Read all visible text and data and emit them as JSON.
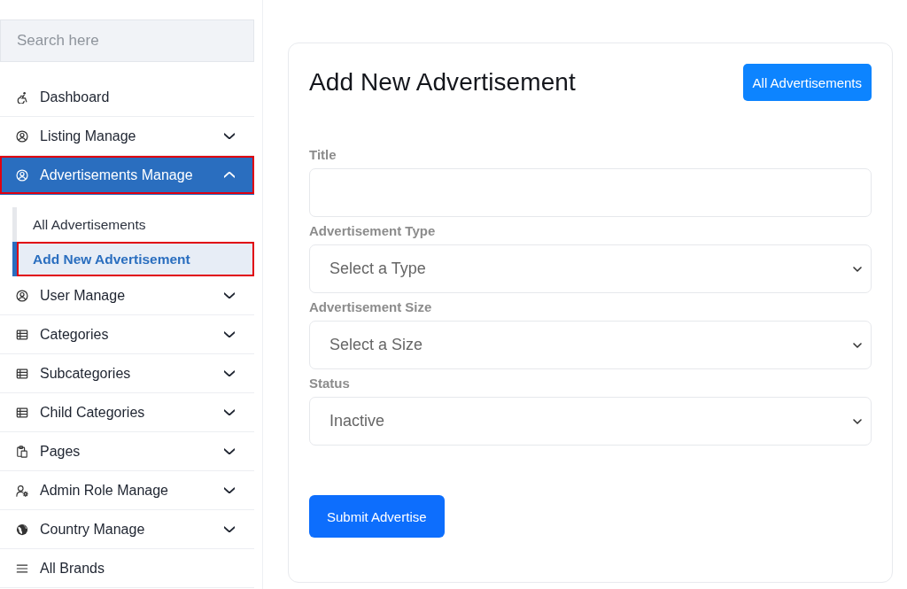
{
  "search": {
    "placeholder": "Search here"
  },
  "sidebar": {
    "items": [
      {
        "label": "Dashboard",
        "kind": "link",
        "selected": false,
        "annotated": false
      },
      {
        "label": "Listing Manage",
        "kind": "menu",
        "expanded": false,
        "selected": false,
        "annotated": false
      },
      {
        "label": "Advertisements Manage",
        "kind": "menu",
        "expanded": true,
        "selected": true,
        "annotated": true,
        "children": [
          {
            "label": "All Advertisements",
            "selected": false,
            "annotated": false
          },
          {
            "label": "Add New Advertisement",
            "selected": true,
            "annotated": true
          }
        ]
      },
      {
        "label": "User Manage",
        "kind": "menu",
        "expanded": false,
        "selected": false,
        "annotated": false
      },
      {
        "label": "Categories",
        "kind": "menu",
        "expanded": false,
        "selected": false,
        "annotated": false
      },
      {
        "label": "Subcategories",
        "kind": "menu",
        "expanded": false,
        "selected": false,
        "annotated": false
      },
      {
        "label": "Child Categories",
        "kind": "menu",
        "expanded": false,
        "selected": false,
        "annotated": false
      },
      {
        "label": "Pages",
        "kind": "menu",
        "expanded": false,
        "selected": false,
        "annotated": false
      },
      {
        "label": "Admin Role Manage",
        "kind": "menu",
        "expanded": false,
        "selected": false,
        "annotated": false
      },
      {
        "label": "Country Manage",
        "kind": "menu",
        "expanded": false,
        "selected": false,
        "annotated": false
      },
      {
        "label": "All Brands",
        "kind": "link",
        "selected": false,
        "annotated": false
      }
    ]
  },
  "form": {
    "title": "Add New Advertisement",
    "header_button": "All Advertisements",
    "fields": [
      {
        "label": "Title",
        "kind": "text"
      },
      {
        "label": "Advertisement Type",
        "kind": "select",
        "value": "Select a Type"
      },
      {
        "label": "Advertisement Size",
        "kind": "select",
        "value": "Select a Size"
      },
      {
        "label": "Status",
        "kind": "select",
        "value": "Inactive"
      }
    ],
    "submit_button": "Submit Advertise"
  }
}
